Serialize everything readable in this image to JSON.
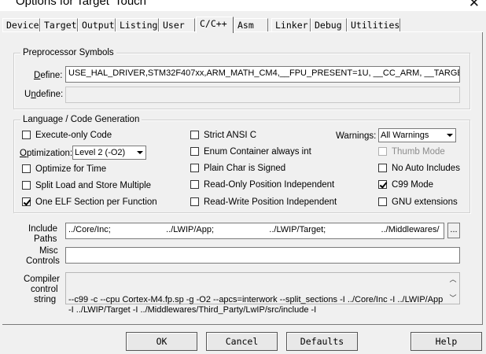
{
  "window": {
    "title": "Options for Target 'Touch'"
  },
  "tabs": [
    "Device",
    "Target",
    "Output",
    "Listing",
    "User",
    "C/C++",
    "Asm",
    "Linker",
    "Debug",
    "Utilities"
  ],
  "active_tab": "C/C++",
  "preprocessor": {
    "title": "Preprocessor Symbols",
    "define_label": "Define:",
    "define_value": "USE_HAL_DRIVER,STM32F407xx,ARM_MATH_CM4,__FPU_PRESENT=1U, __CC_ARM, __TARGET",
    "undefine_label": "Undefine:",
    "undefine_value": ""
  },
  "codegen": {
    "title": "Language / Code Generation",
    "execute_only": {
      "label": "Execute-only Code",
      "checked": false
    },
    "optimization_label": "Optimization:",
    "optimization_value": "Level 2 (-O2)",
    "optimize_time": {
      "label": "Optimize for Time",
      "checked": false
    },
    "split_load": {
      "label": "Split Load and Store Multiple",
      "checked": false
    },
    "one_elf": {
      "label": "One ELF Section per Function",
      "checked": true
    },
    "strict_ansi": {
      "label": "Strict ANSI C",
      "checked": false
    },
    "enum_container": {
      "label": "Enum Container always int",
      "checked": false
    },
    "plain_char": {
      "label": "Plain Char is Signed",
      "checked": false
    },
    "ro_pos": {
      "label": "Read-Only Position Independent",
      "checked": false
    },
    "rw_pos": {
      "label": "Read-Write Position Independent",
      "checked": false
    },
    "warnings_label": "Warnings:",
    "warnings_value": "All Warnings",
    "thumb_mode": {
      "label": "Thumb Mode",
      "checked": false
    },
    "no_auto_includes": {
      "label": "No Auto Includes",
      "checked": false
    },
    "c99_mode": {
      "label": "C99 Mode",
      "checked": true
    },
    "gnu_ext": {
      "label": "GNU extensions",
      "checked": false
    }
  },
  "include": {
    "label_line1": "Include",
    "label_line2": "Paths",
    "value": "../Core/Inc;                       ../LWIP/App;                       ../LWIP/Target;                       ../Middlewares/",
    "browse_label": "..."
  },
  "misc": {
    "label_line1": "Misc",
    "label_line2": "Controls",
    "value": ""
  },
  "compiler": {
    "label_line1": "Compiler",
    "label_line2": "control",
    "label_line3": "string",
    "value": "--c99 -c --cpu Cortex-M4.fp.sp -g -O2 --apcs=interwork --split_sections -I ../Core/Inc -I ../LWIP/App -I ../LWIP/Target -I ../Middlewares/Third_Party/LwIP/src/include -I"
  },
  "buttons": {
    "ok": "OK",
    "cancel": "Cancel",
    "defaults": "Defaults",
    "help": "Help"
  }
}
